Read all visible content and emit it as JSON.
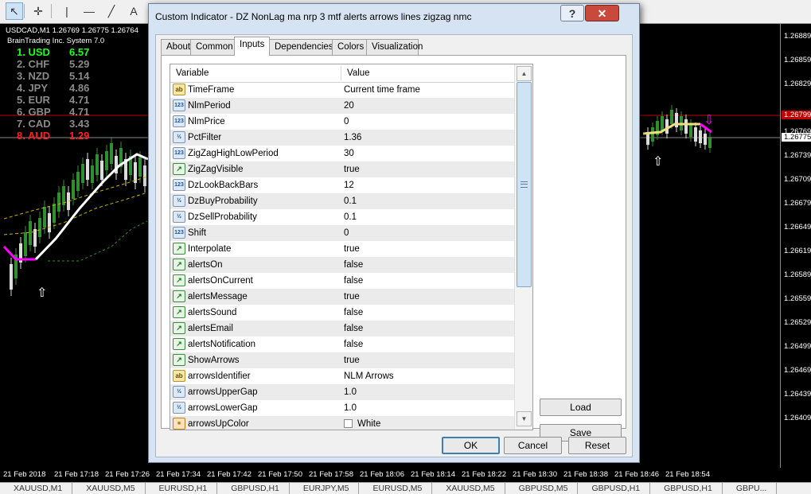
{
  "toolbar": {
    "buttons": [
      {
        "name": "cursor-icon",
        "glyph": "↖",
        "active": true
      },
      {
        "name": "crosshair-icon",
        "glyph": "✛",
        "active": false
      },
      {
        "name": "vertical-line-icon",
        "glyph": "|",
        "active": false
      },
      {
        "name": "horizontal-line-icon",
        "glyph": "—",
        "active": false
      },
      {
        "name": "trendline-icon",
        "glyph": "╱",
        "active": false
      },
      {
        "name": "text-tool-icon",
        "glyph": "A",
        "active": false
      }
    ]
  },
  "chart": {
    "title": "USDCAD,M1  1.26769 1.26775 1.26764",
    "subtitle": "BrainTrading Inc. System 7.0",
    "strength": [
      {
        "rank": "1. USD",
        "value": "6.57",
        "color": "#22ff22"
      },
      {
        "rank": "2. CHF",
        "value": "5.29",
        "color": "#8a8a8a"
      },
      {
        "rank": "3. NZD",
        "value": "5.14",
        "color": "#8a8a8a"
      },
      {
        "rank": "4. JPY",
        "value": "4.86",
        "color": "#8a8a8a"
      },
      {
        "rank": "5. EUR",
        "value": "4.71",
        "color": "#8a8a8a"
      },
      {
        "rank": "6. GBP",
        "value": "4.71",
        "color": "#8a8a8a"
      },
      {
        "rank": "7. CAD",
        "value": "3.43",
        "color": "#8a8a8a"
      },
      {
        "rank": "8. AUD",
        "value": "1.29",
        "color": "#ff2020"
      }
    ],
    "price_ticks": [
      "1.26889",
      "1.26859",
      "1.26829",
      "1.26769",
      "1.26739",
      "1.26709",
      "1.26679",
      "1.26649",
      "1.26619",
      "1.26589",
      "1.26559",
      "1.26529",
      "1.26499",
      "1.26469",
      "1.26439",
      "1.26409"
    ],
    "price_tag_red": "1.26799",
    "price_tag_white": "1.26775",
    "time_ticks": [
      "21 Feb 2018",
      "21 Feb 17:18",
      "21 Feb 17:26",
      "21 Feb 17:34",
      "21 Feb 17:42",
      "21 Feb 17:50",
      "21 Feb 17:58",
      "21 Feb 18:06",
      "21 Feb 18:14",
      "21 Feb 18:22",
      "21 Feb 18:30",
      "21 Feb 18:38",
      "21 Feb 18:46",
      "21 Feb 18:54"
    ],
    "colors": {
      "bull": "#2f8f2f",
      "bear": "#dcdcdc",
      "nlm_up": "#ffffff",
      "nlm_down": "#ff00ff",
      "bands": "#c8b400",
      "lower": "#2e8f2e"
    }
  },
  "symbol_tabs": [
    "XAUUSD,M1",
    "XAUUSD,M5",
    "EURUSD,H1",
    "GBPUSD,H1",
    "EURJPY,M5",
    "EURUSD,M5",
    "XAUUSD,M5",
    "GBPUSD,M5",
    "GBPUSD,H1",
    "GBPUSD,H1",
    "GBPU..."
  ],
  "dialog": {
    "title": "Custom Indicator - DZ NonLag ma nrp 3 mtf alerts arrows lines zigzag nmc",
    "help_label": "?",
    "close_label": "✕",
    "tabs": [
      "About",
      "Common",
      "Inputs",
      "Dependencies",
      "Colors",
      "Visualization"
    ],
    "active_tab": 2,
    "grid": {
      "col_variable": "Variable",
      "col_value": "Value",
      "rows": [
        {
          "icon": "ab",
          "icon_text": "ab",
          "var": "TimeFrame",
          "val": "Current time frame"
        },
        {
          "icon": "int",
          "icon_text": "123",
          "var": "NlmPeriod",
          "val": "20"
        },
        {
          "icon": "int",
          "icon_text": "123",
          "var": "NlmPrice",
          "val": "0"
        },
        {
          "icon": "dbl",
          "icon_text": "½",
          "var": "PctFilter",
          "val": "1.36"
        },
        {
          "icon": "int",
          "icon_text": "123",
          "var": "ZigZagHighLowPeriod",
          "val": "30"
        },
        {
          "icon": "trend",
          "icon_text": "↗",
          "var": "ZigZagVisible",
          "val": "true"
        },
        {
          "icon": "int",
          "icon_text": "123",
          "var": "DzLookBackBars",
          "val": "12"
        },
        {
          "icon": "dbl",
          "icon_text": "½",
          "var": "DzBuyProbability",
          "val": "0.1"
        },
        {
          "icon": "dbl",
          "icon_text": "½",
          "var": "DzSellProbability",
          "val": "0.1"
        },
        {
          "icon": "int",
          "icon_text": "123",
          "var": "Shift",
          "val": "0"
        },
        {
          "icon": "trend",
          "icon_text": "↗",
          "var": "Interpolate",
          "val": "true"
        },
        {
          "icon": "trend",
          "icon_text": "↗",
          "var": "alertsOn",
          "val": "false"
        },
        {
          "icon": "trend",
          "icon_text": "↗",
          "var": "alertsOnCurrent",
          "val": "false"
        },
        {
          "icon": "trend",
          "icon_text": "↗",
          "var": "alertsMessage",
          "val": "true"
        },
        {
          "icon": "trend",
          "icon_text": "↗",
          "var": "alertsSound",
          "val": "false"
        },
        {
          "icon": "trend",
          "icon_text": "↗",
          "var": "alertsEmail",
          "val": "false"
        },
        {
          "icon": "trend",
          "icon_text": "↗",
          "var": "alertsNotification",
          "val": "false"
        },
        {
          "icon": "trend",
          "icon_text": "↗",
          "var": "ShowArrows",
          "val": "true"
        },
        {
          "icon": "ab",
          "icon_text": "ab",
          "var": "arrowsIdentifier",
          "val": "NLM Arrows"
        },
        {
          "icon": "dbl",
          "icon_text": "½",
          "var": "arrowsUpperGap",
          "val": "1.0"
        },
        {
          "icon": "dbl",
          "icon_text": "½",
          "var": "arrowsLowerGap",
          "val": "1.0"
        },
        {
          "icon": "color",
          "icon_text": "■",
          "var": "arrowsUpColor",
          "val": "White",
          "swatch": "#ffffff"
        }
      ]
    },
    "load_label": "Load",
    "save_label": "Save",
    "ok_label": "OK",
    "cancel_label": "Cancel",
    "reset_label": "Reset"
  }
}
